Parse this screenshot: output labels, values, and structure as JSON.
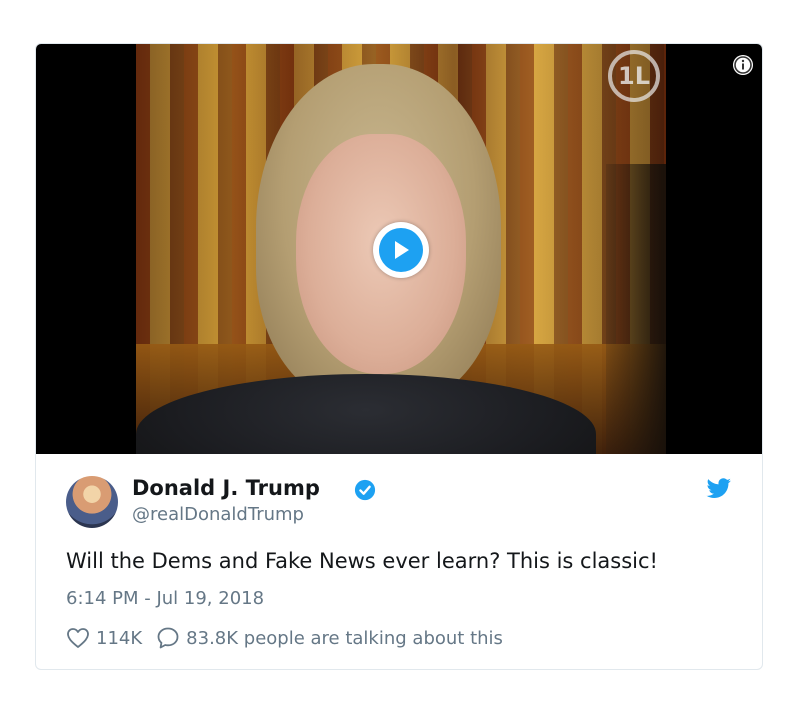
{
  "video": {
    "watermark_text": "1L",
    "play_icon": "play-icon",
    "info_icon": "info-icon"
  },
  "tweet": {
    "author_name": "Donald J. Trump",
    "handle": "@realDonaldTrump",
    "verified": true,
    "text": "Will the Dems and Fake News ever learn? This is classic!",
    "timestamp": "6:14 PM - Jul 19, 2018",
    "likes": "114K",
    "talking": "83.8K people are talking about this"
  },
  "colors": {
    "twitter_blue": "#1da1f2",
    "text_primary": "#14171a",
    "text_secondary": "#657786",
    "border": "#e1e8ed"
  }
}
